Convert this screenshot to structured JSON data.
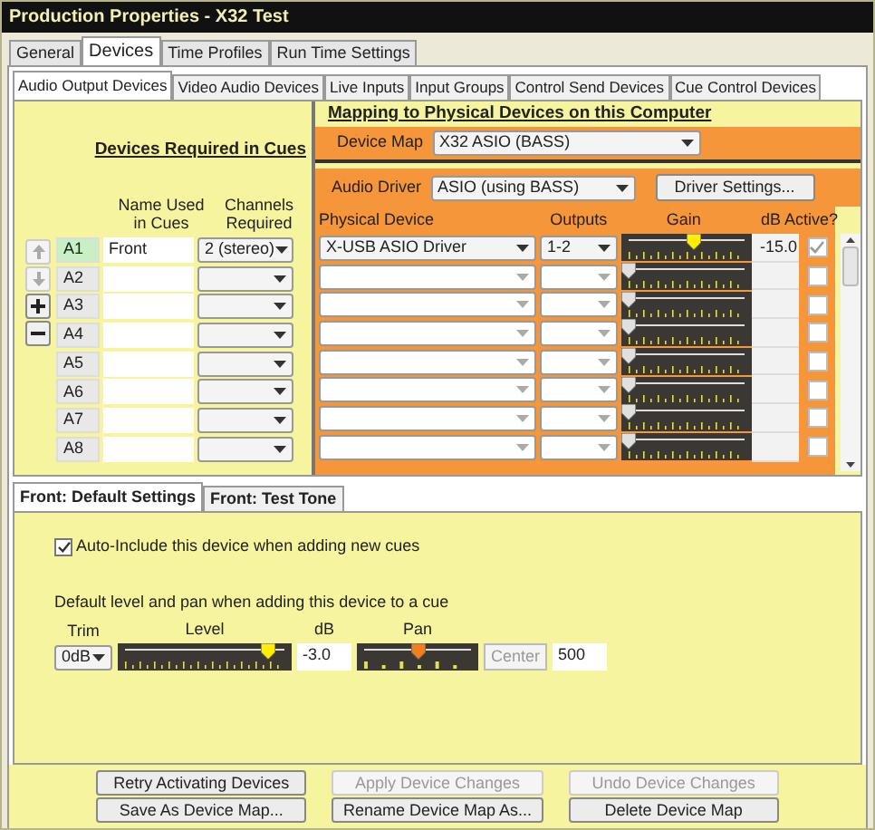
{
  "window": {
    "title": "Production Properties - X32 Test"
  },
  "tabs": [
    {
      "label": "General",
      "selected": false
    },
    {
      "label": "Devices",
      "selected": true
    },
    {
      "label": "Time Profiles",
      "selected": false
    },
    {
      "label": "Run Time Settings",
      "selected": false
    }
  ],
  "sub_tabs": [
    {
      "label": "Audio Output Devices",
      "selected": true
    },
    {
      "label": "Video Audio Devices",
      "selected": false
    },
    {
      "label": "Live Inputs",
      "selected": false
    },
    {
      "label": "Input Groups",
      "selected": false
    },
    {
      "label": "Control Send Devices",
      "selected": false
    },
    {
      "label": "Cue Control Devices",
      "selected": false
    }
  ],
  "cue_devices": {
    "heading": "Devices Required in Cues",
    "columns": [
      "Name Used in Cues",
      "Channels Required"
    ]
  },
  "reorder_buttons": [
    {
      "kind": "up",
      "disabled": true
    },
    {
      "kind": "down",
      "disabled": true
    },
    {
      "kind": "add",
      "disabled": false
    },
    {
      "kind": "remove",
      "disabled": false
    }
  ],
  "mapping": {
    "heading": "Mapping to Physical Devices on this Computer",
    "device_map": {
      "label": "Device Map",
      "value": "X32 ASIO (BASS)"
    },
    "audio_driver": {
      "label": "Audio Driver",
      "value": "ASIO (using BASS)"
    },
    "driver_button": "Driver Settings...",
    "columns": [
      "Physical Device",
      "Outputs",
      "Gain",
      "dB",
      "Active?"
    ]
  },
  "rows": [
    {
      "label": "A1",
      "selected": true,
      "name": "Front",
      "channels": "2 (stereo)",
      "device": "X-USB ASIO Driver",
      "outputs": "1-2",
      "level": 0.57,
      "db": "-15.0",
      "active": true,
      "enabled": true
    },
    {
      "label": "A2",
      "selected": false,
      "level": 0,
      "active": false,
      "enabled": false
    },
    {
      "label": "A3",
      "selected": false,
      "level": 0,
      "active": false,
      "enabled": false
    },
    {
      "label": "A4",
      "selected": false,
      "level": 0,
      "active": false,
      "enabled": false
    },
    {
      "label": "A5",
      "selected": false,
      "level": 0,
      "active": false,
      "enabled": false
    },
    {
      "label": "A6",
      "selected": false,
      "level": 0,
      "active": false,
      "enabled": false
    },
    {
      "label": "A7",
      "selected": false,
      "level": 0,
      "active": false,
      "enabled": false
    },
    {
      "label": "A8",
      "selected": false,
      "level": 0,
      "active": false,
      "enabled": false
    }
  ],
  "settings_tabs": [
    {
      "label": "Front: Default Settings",
      "selected": true
    },
    {
      "label": "Front: Test Tone",
      "selected": false
    }
  ],
  "auto_include": {
    "label": "Auto-Include this device when adding new cues",
    "checked": true
  },
  "defaults": {
    "caption": "Default level and pan when adding this device to a cue",
    "trim": {
      "label": "Trim",
      "value": "0dB"
    },
    "level": {
      "label": "Level",
      "level": 0.9
    },
    "db": {
      "label": "dB",
      "value": "-3.0"
    },
    "pan": {
      "label": "Pan",
      "level": 0.5
    },
    "center_button": "Center",
    "pan_value": "500"
  },
  "buttons": [
    {
      "label": "Retry Activating Devices",
      "disabled": false
    },
    {
      "label": "Apply Device Changes",
      "disabled": true
    },
    {
      "label": "Undo Device Changes",
      "disabled": true
    },
    {
      "label": "Save As Device Map...",
      "disabled": false
    },
    {
      "label": "Rename Device Map As...",
      "disabled": false
    },
    {
      "label": "Delete Device Map",
      "disabled": false
    }
  ]
}
